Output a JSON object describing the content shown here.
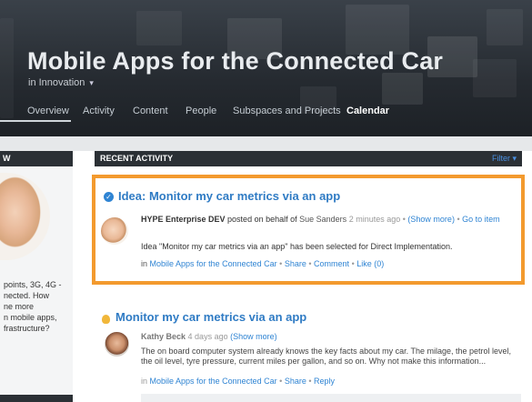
{
  "banner": {
    "title": "Mobile Apps for the Connected Car",
    "subtitle": "in Innovation",
    "tabs": [
      {
        "label": "Overview",
        "active": false
      },
      {
        "label": "Activity",
        "active": false
      },
      {
        "label": "Content",
        "active": false
      },
      {
        "label": "People",
        "active": false
      },
      {
        "label": "Subspaces and Projects",
        "active": false
      },
      {
        "label": "Calendar",
        "active": true
      }
    ]
  },
  "left_panel": {
    "header": "W",
    "text_lines": [
      "points, 3G, 4G -",
      "nected. How",
      "ne more",
      "n mobile apps,",
      "frastructure?"
    ]
  },
  "recent_activity": {
    "header": "RECENT ACTIVITY",
    "filter_label": "Filter ▾",
    "card": {
      "title": "Idea: Monitor my car metrics via an app",
      "author": "HYPE Enterprise DEV",
      "behalf_text": "posted on behalf of",
      "behalf_user": "Sue Sanders",
      "time": "2 minutes ago",
      "show_more": "(Show more)",
      "go_to": "Go to item",
      "message": "Idea \"Monitor my car metrics via an app\" has been selected for Direct Implementation.",
      "in_label": "in",
      "space_link": "Mobile Apps for the Connected Car",
      "share": "Share",
      "comment": "Comment",
      "like": "Like (0)"
    },
    "item2": {
      "title": "Monitor my car metrics via an app",
      "author": "Kathy Beck",
      "time": "4 days ago",
      "show_more": "(Show more)",
      "body": "The on board computer system already knows the key facts about my car. The milage, the petrol level, the oil level, tyre pressure, current miles per gallon, and so on. Why not make this information...",
      "in_label": "in",
      "space_link": "Mobile Apps for the Connected Car",
      "share": "Share",
      "reply": "Reply"
    }
  },
  "colors": {
    "accent": "#2f7bc4",
    "highlight": "#f39a2e",
    "dark_header": "#2b3035"
  }
}
